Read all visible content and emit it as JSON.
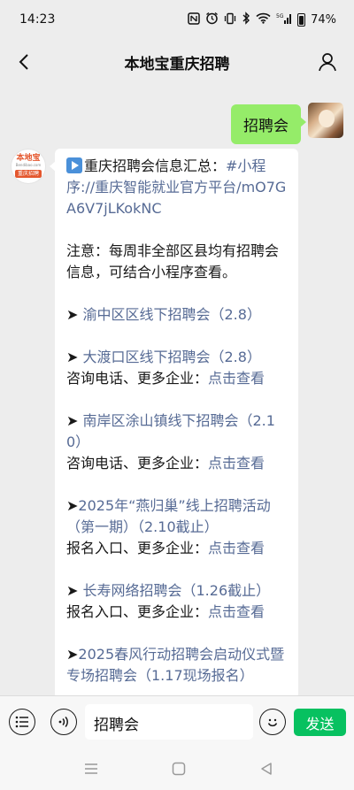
{
  "status_bar": {
    "time": "14:23",
    "icons": [
      "nfc-icon",
      "alarm-icon",
      "vibrate-icon",
      "bluetooth-icon",
      "wifi-icon",
      "signal-5g-icon",
      "battery-icon"
    ],
    "battery": "74%"
  },
  "header": {
    "title": "本地宝重庆招聘"
  },
  "chat": {
    "outgoing": {
      "text": "招聘会"
    },
    "bot_avatar": {
      "logo_text": "本地宝",
      "logo_sub": "Bendibao.com",
      "logo_badge": "重庆招聘"
    },
    "incoming": {
      "p1_text": "重庆招聘会信息汇总：",
      "p1_link": "#小程序://重庆智能就业官方平台/mO7GA6V7jLKokNC",
      "p2": "注意：每周非全部区县均有招聘会信息，可结合小程序查看。",
      "items": [
        {
          "arrow": "➤ ",
          "title": "渝中区区线下招聘会（2.8）"
        },
        {
          "arrow": "➤ ",
          "title": "大渡口区线下招聘会（2.8）",
          "label": "咨询电话、更多企业：",
          "link": "点击查看"
        },
        {
          "arrow": "➤ ",
          "title": "南岸区涂山镇线下招聘会（2.10）",
          "label": "咨询电话、更多企业：",
          "link": "点击查看"
        },
        {
          "arrow": "➤",
          "title": "2025年“燕归巢”线上招聘活动（第一期）（2.10截止）",
          "label": "报名入口、更多企业：",
          "link": "点击查看"
        },
        {
          "arrow": "➤ ",
          "title": "长寿网络招聘会（1.26截止）",
          "label": "报名入口、更多企业：",
          "link": "点击查看"
        },
        {
          "arrow": "➤",
          "title": "2025春风行动招聘会启动仪式暨专场招聘会（1.17现场报名）"
        }
      ]
    }
  },
  "input_bar": {
    "value": "招聘会",
    "send_label": "发送"
  },
  "colors": {
    "outgoing_bubble": "#95ec69",
    "link": "#576b95",
    "send_button": "#07c160",
    "background": "#ededed"
  }
}
